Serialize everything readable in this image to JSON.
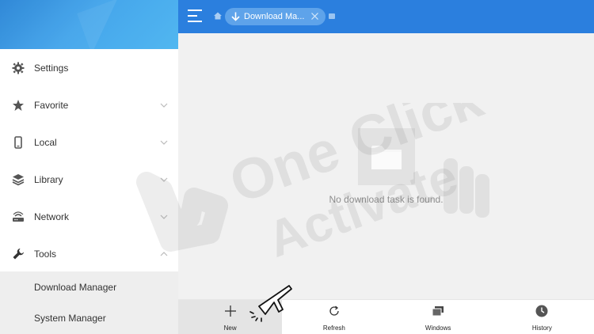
{
  "sidebar": {
    "items": [
      {
        "label": "Settings",
        "icon": "gear-icon"
      },
      {
        "label": "Favorite",
        "icon": "star-icon"
      },
      {
        "label": "Local",
        "icon": "phone-icon"
      },
      {
        "label": "Library",
        "icon": "layers-icon"
      },
      {
        "label": "Network",
        "icon": "router-icon"
      },
      {
        "label": "Tools",
        "icon": "wrench-icon"
      }
    ],
    "subitems": [
      {
        "label": "Download Manager"
      },
      {
        "label": "System Manager"
      }
    ]
  },
  "header": {
    "tab_label": "Download Ma...",
    "accent": "#2b7fde"
  },
  "content": {
    "empty_message": "No download task is found."
  },
  "bottombar": {
    "items": [
      {
        "label": "New",
        "icon": "plus-icon"
      },
      {
        "label": "Refresh",
        "icon": "refresh-icon"
      },
      {
        "label": "Windows",
        "icon": "windows-icon"
      },
      {
        "label": "History",
        "icon": "clock-icon"
      }
    ]
  },
  "watermark": {
    "line1": "One Click",
    "line2": "Activate"
  }
}
